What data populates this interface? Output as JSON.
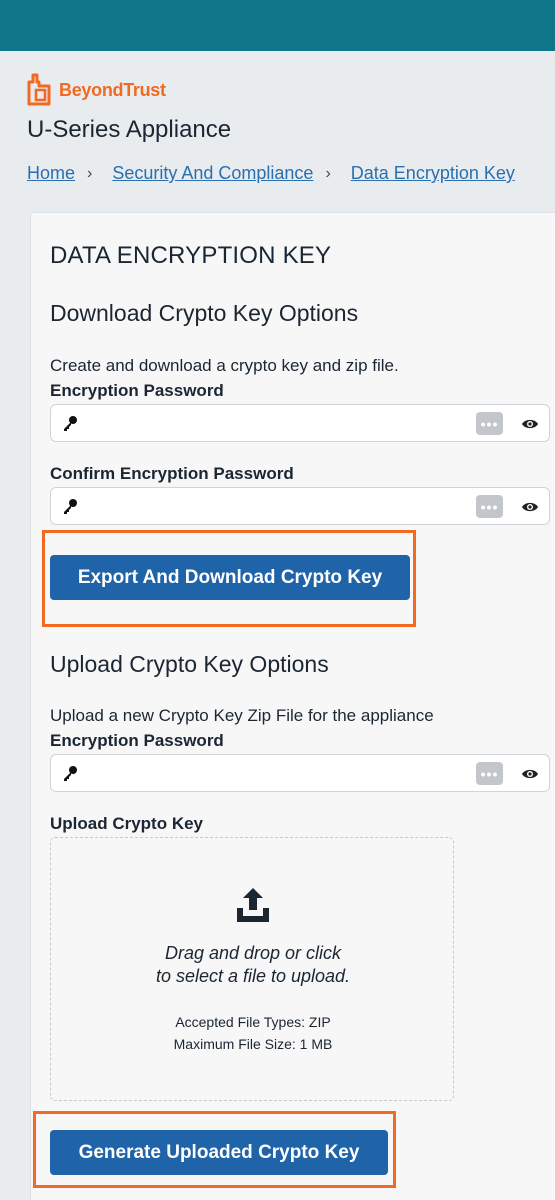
{
  "brand": {
    "name": "BeyondTrust",
    "color": "#f26a21",
    "header_color": "#0f7689"
  },
  "app": {
    "title": "U-Series Appliance"
  },
  "breadcrumb": [
    {
      "label": "Home"
    },
    {
      "label": "Security And Compliance"
    },
    {
      "label": "Data Encryption Key"
    }
  ],
  "page": {
    "title": "DATA ENCRYPTION KEY",
    "download": {
      "heading": "Download Crypto Key Options",
      "description": "Create and download a crypto key and zip file.",
      "password_label": "Encryption Password",
      "confirm_label": "Confirm Encryption Password",
      "button_label": "Export And Download Crypto Key"
    },
    "upload": {
      "heading": "Upload Crypto Key Options",
      "description": "Upload a new Crypto Key Zip File for the appliance",
      "password_label": "Encryption Password",
      "file_label": "Upload Crypto Key",
      "drop_line1": "Drag and drop or click",
      "drop_line2": "to select a file to upload.",
      "accepted_types": "Accepted File Types: ZIP",
      "max_size": "Maximum File Size: 1 MB",
      "button_label": "Generate Uploaded Crypto Key"
    }
  },
  "icons": {
    "key": "key-icon",
    "generate_password": "dots-icon",
    "show_password": "eye-icon",
    "upload": "upload-icon"
  },
  "colors": {
    "primary_button": "#1f63a8",
    "highlight": "#f26a21",
    "link": "#2a6fb0"
  }
}
